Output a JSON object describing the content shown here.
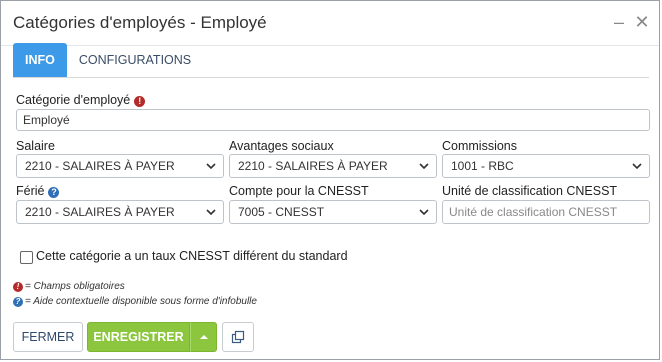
{
  "window": {
    "title": "Catégories d'employés - Employé",
    "minimize_label": "–",
    "close_label": "✕"
  },
  "tabs": [
    {
      "label": "INFO",
      "active": true
    },
    {
      "label": "CONFIGURATIONS",
      "active": false
    }
  ],
  "form": {
    "categorie": {
      "label": "Catégorie d'employé",
      "value": "Employé",
      "required": true
    },
    "salaire": {
      "label": "Salaire",
      "value": "2210 - SALAIRES À PAYER"
    },
    "avantages": {
      "label": "Avantages sociaux",
      "value": "2210 - SALAIRES À PAYER"
    },
    "commissions": {
      "label": "Commissions",
      "value": "1001 - RBC"
    },
    "ferie": {
      "label": "Férié",
      "value": "2210 - SALAIRES À PAYER",
      "help": true
    },
    "compte_cnesst": {
      "label": "Compte pour la CNESST",
      "value": "7005 - CNESST"
    },
    "unite_cnesst": {
      "label": "Unité de classification CNESST",
      "value": "",
      "placeholder": "Unité de classification CNESST"
    },
    "taux_checkbox": {
      "label": "Cette catégorie a un taux CNESST différent du standard",
      "checked": false
    }
  },
  "legend": {
    "required_text": "= Champs obligatoires",
    "help_text": "= Aide contextuelle disponible sous forme d'infobulle",
    "required_icon": "exclamation-circle-icon",
    "help_icon": "question-circle-icon"
  },
  "buttons": {
    "fermer": "FERMER",
    "enregistrer": "ENREGISTRER",
    "dropdown_icon": "caret-up-icon",
    "copy_icon": "copy-icon"
  },
  "colors": {
    "tab_active": "#3c9ae8",
    "save_button": "#8cc63f",
    "required": "#b52a2a",
    "help": "#2f6fb6"
  }
}
